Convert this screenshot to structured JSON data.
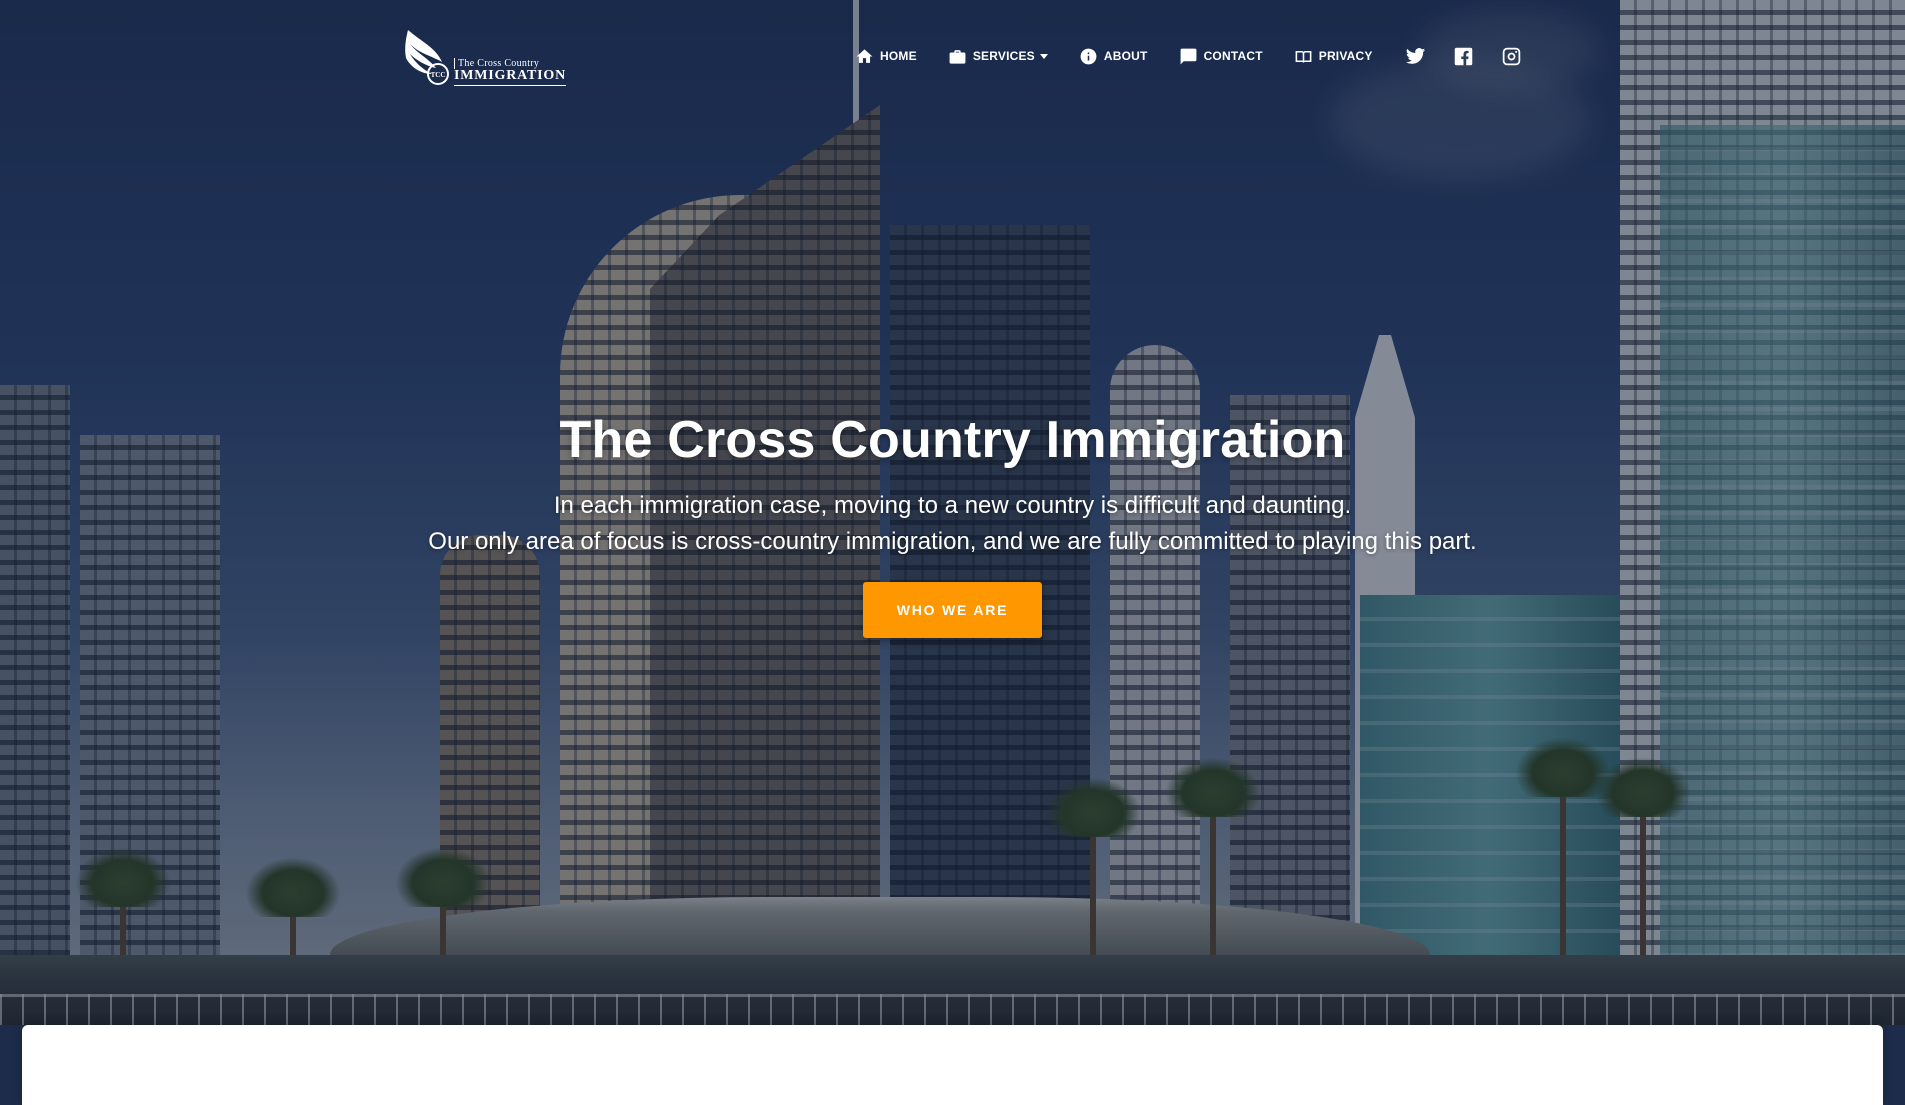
{
  "brand": {
    "line1": "The Cross Country",
    "line2": "IMMIGRATION",
    "logo_icon": "wing-logo-icon"
  },
  "nav": {
    "items": [
      {
        "label": "HOME",
        "icon": "home-icon"
      },
      {
        "label": "SERVICES",
        "icon": "briefcase-icon",
        "dropdown": true
      },
      {
        "label": "ABOUT",
        "icon": "info-icon"
      },
      {
        "label": "CONTACT",
        "icon": "chat-icon"
      },
      {
        "label": "PRIVACY",
        "icon": "book-icon"
      }
    ],
    "social": [
      {
        "icon": "twitter-icon"
      },
      {
        "icon": "facebook-icon"
      },
      {
        "icon": "instagram-icon"
      }
    ]
  },
  "hero": {
    "title": "The Cross Country Immigration",
    "subtitle_line1": "In each immigration case, moving to a new country is difficult and daunting.",
    "subtitle_line2": "Our only area of focus is cross-country immigration, and we are fully committed to playing this part.",
    "cta_label": "WHO WE ARE"
  },
  "colors": {
    "accent": "#ff9800",
    "overlay": "#0e1830"
  }
}
